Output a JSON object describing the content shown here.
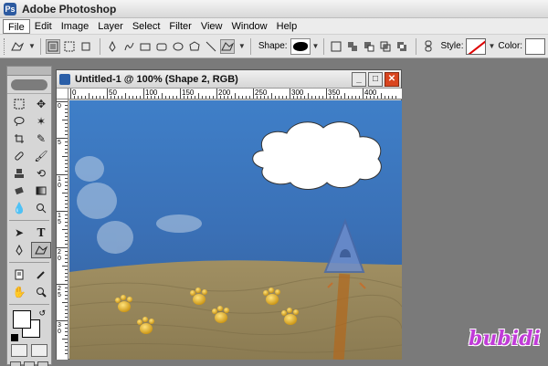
{
  "app": {
    "title": "Adobe Photoshop",
    "icon": "photoshop-logo-icon"
  },
  "menu": [
    {
      "label": "File",
      "active": true
    },
    {
      "label": "Edit"
    },
    {
      "label": "Image"
    },
    {
      "label": "Layer"
    },
    {
      "label": "Select"
    },
    {
      "label": "Filter"
    },
    {
      "label": "View"
    },
    {
      "label": "Window"
    },
    {
      "label": "Help"
    }
  ],
  "options_bar": {
    "shape_label": "Shape:",
    "style_label": "Style:",
    "color_label": "Color:"
  },
  "document": {
    "title": "Untitled-1 @ 100% (Shape 2, RGB)",
    "ruler_h": [
      "0",
      "50",
      "100",
      "150",
      "200",
      "250",
      "300",
      "350",
      "400"
    ],
    "ruler_v": [
      "0",
      "5",
      "10",
      "15",
      "20",
      "25",
      "30"
    ]
  },
  "colors": {
    "sky": "#3f7fc8",
    "sand": "#9a8a5e",
    "paw": "#e0a820",
    "sign": "#6d8dcc",
    "close_button": "#d9451f",
    "watermark": "#c13bd8"
  },
  "watermark": "bubidi"
}
